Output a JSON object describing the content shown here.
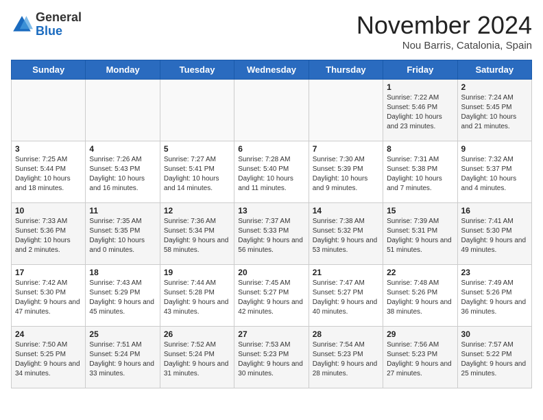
{
  "logo": {
    "general": "General",
    "blue": "Blue"
  },
  "title": "November 2024",
  "location": "Nou Barris, Catalonia, Spain",
  "days_of_week": [
    "Sunday",
    "Monday",
    "Tuesday",
    "Wednesday",
    "Thursday",
    "Friday",
    "Saturday"
  ],
  "weeks": [
    [
      {
        "day": "",
        "info": ""
      },
      {
        "day": "",
        "info": ""
      },
      {
        "day": "",
        "info": ""
      },
      {
        "day": "",
        "info": ""
      },
      {
        "day": "",
        "info": ""
      },
      {
        "day": "1",
        "info": "Sunrise: 7:22 AM\nSunset: 5:46 PM\nDaylight: 10 hours and 23 minutes."
      },
      {
        "day": "2",
        "info": "Sunrise: 7:24 AM\nSunset: 5:45 PM\nDaylight: 10 hours and 21 minutes."
      }
    ],
    [
      {
        "day": "3",
        "info": "Sunrise: 7:25 AM\nSunset: 5:44 PM\nDaylight: 10 hours and 18 minutes."
      },
      {
        "day": "4",
        "info": "Sunrise: 7:26 AM\nSunset: 5:43 PM\nDaylight: 10 hours and 16 minutes."
      },
      {
        "day": "5",
        "info": "Sunrise: 7:27 AM\nSunset: 5:41 PM\nDaylight: 10 hours and 14 minutes."
      },
      {
        "day": "6",
        "info": "Sunrise: 7:28 AM\nSunset: 5:40 PM\nDaylight: 10 hours and 11 minutes."
      },
      {
        "day": "7",
        "info": "Sunrise: 7:30 AM\nSunset: 5:39 PM\nDaylight: 10 hours and 9 minutes."
      },
      {
        "day": "8",
        "info": "Sunrise: 7:31 AM\nSunset: 5:38 PM\nDaylight: 10 hours and 7 minutes."
      },
      {
        "day": "9",
        "info": "Sunrise: 7:32 AM\nSunset: 5:37 PM\nDaylight: 10 hours and 4 minutes."
      }
    ],
    [
      {
        "day": "10",
        "info": "Sunrise: 7:33 AM\nSunset: 5:36 PM\nDaylight: 10 hours and 2 minutes."
      },
      {
        "day": "11",
        "info": "Sunrise: 7:35 AM\nSunset: 5:35 PM\nDaylight: 10 hours and 0 minutes."
      },
      {
        "day": "12",
        "info": "Sunrise: 7:36 AM\nSunset: 5:34 PM\nDaylight: 9 hours and 58 minutes."
      },
      {
        "day": "13",
        "info": "Sunrise: 7:37 AM\nSunset: 5:33 PM\nDaylight: 9 hours and 56 minutes."
      },
      {
        "day": "14",
        "info": "Sunrise: 7:38 AM\nSunset: 5:32 PM\nDaylight: 9 hours and 53 minutes."
      },
      {
        "day": "15",
        "info": "Sunrise: 7:39 AM\nSunset: 5:31 PM\nDaylight: 9 hours and 51 minutes."
      },
      {
        "day": "16",
        "info": "Sunrise: 7:41 AM\nSunset: 5:30 PM\nDaylight: 9 hours and 49 minutes."
      }
    ],
    [
      {
        "day": "17",
        "info": "Sunrise: 7:42 AM\nSunset: 5:30 PM\nDaylight: 9 hours and 47 minutes."
      },
      {
        "day": "18",
        "info": "Sunrise: 7:43 AM\nSunset: 5:29 PM\nDaylight: 9 hours and 45 minutes."
      },
      {
        "day": "19",
        "info": "Sunrise: 7:44 AM\nSunset: 5:28 PM\nDaylight: 9 hours and 43 minutes."
      },
      {
        "day": "20",
        "info": "Sunrise: 7:45 AM\nSunset: 5:27 PM\nDaylight: 9 hours and 42 minutes."
      },
      {
        "day": "21",
        "info": "Sunrise: 7:47 AM\nSunset: 5:27 PM\nDaylight: 9 hours and 40 minutes."
      },
      {
        "day": "22",
        "info": "Sunrise: 7:48 AM\nSunset: 5:26 PM\nDaylight: 9 hours and 38 minutes."
      },
      {
        "day": "23",
        "info": "Sunrise: 7:49 AM\nSunset: 5:26 PM\nDaylight: 9 hours and 36 minutes."
      }
    ],
    [
      {
        "day": "24",
        "info": "Sunrise: 7:50 AM\nSunset: 5:25 PM\nDaylight: 9 hours and 34 minutes."
      },
      {
        "day": "25",
        "info": "Sunrise: 7:51 AM\nSunset: 5:24 PM\nDaylight: 9 hours and 33 minutes."
      },
      {
        "day": "26",
        "info": "Sunrise: 7:52 AM\nSunset: 5:24 PM\nDaylight: 9 hours and 31 minutes."
      },
      {
        "day": "27",
        "info": "Sunrise: 7:53 AM\nSunset: 5:23 PM\nDaylight: 9 hours and 30 minutes."
      },
      {
        "day": "28",
        "info": "Sunrise: 7:54 AM\nSunset: 5:23 PM\nDaylight: 9 hours and 28 minutes."
      },
      {
        "day": "29",
        "info": "Sunrise: 7:56 AM\nSunset: 5:23 PM\nDaylight: 9 hours and 27 minutes."
      },
      {
        "day": "30",
        "info": "Sunrise: 7:57 AM\nSunset: 5:22 PM\nDaylight: 9 hours and 25 minutes."
      }
    ]
  ]
}
